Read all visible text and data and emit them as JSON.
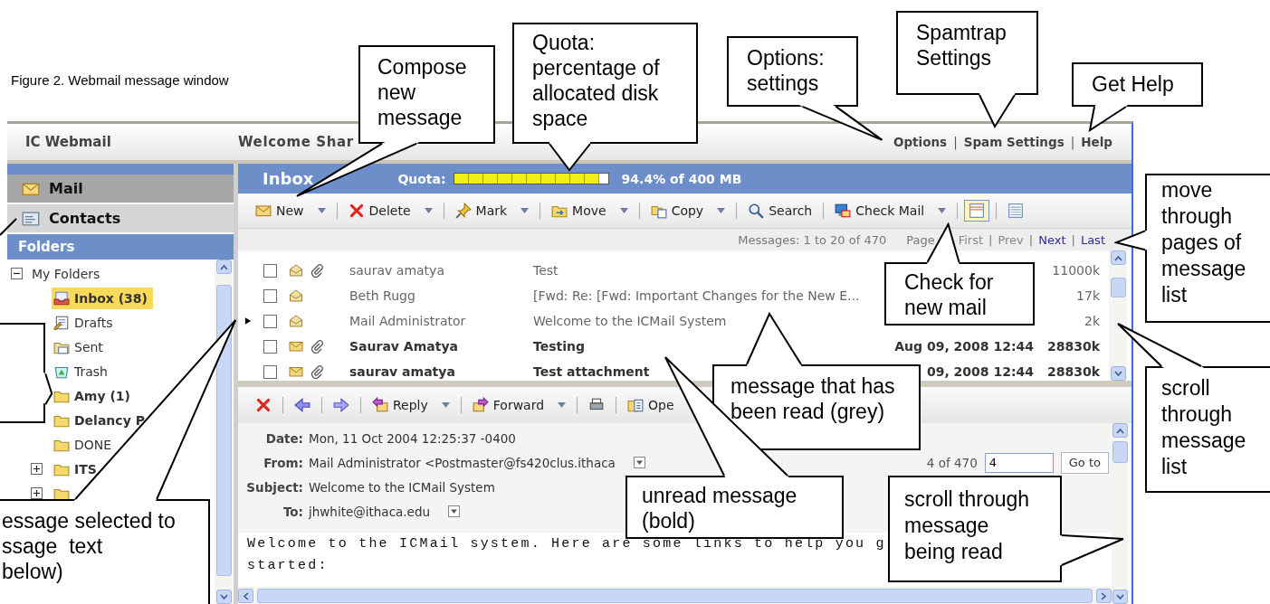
{
  "caption": "Figure 2. Webmail message window",
  "header": {
    "app_name": "IC Webmail",
    "welcome": "Welcome Shar",
    "separator": "|",
    "links": [
      "Options",
      "Spam Settings",
      "Help"
    ]
  },
  "sidebar": {
    "nav": [
      {
        "label": "Mail",
        "kind": "mail",
        "selected": true
      },
      {
        "label": "Contacts",
        "kind": "contacts",
        "selected": false
      }
    ],
    "folders_title": "Folders",
    "tree": [
      {
        "label": "My Folders",
        "kind": "group",
        "expanded": true,
        "children": [
          {
            "label": "Inbox (38)",
            "kind": "inbox",
            "selected": true,
            "unread": true,
            "collapsed": false
          },
          {
            "label": "Drafts",
            "kind": "drafts",
            "selected": false,
            "unread": false,
            "collapsed": false
          },
          {
            "label": "Sent",
            "kind": "sent",
            "selected": false,
            "unread": false,
            "collapsed": false
          },
          {
            "label": "Trash",
            "kind": "trash",
            "selected": false,
            "unread": false,
            "collapsed": false
          },
          {
            "label": "Amy (1)",
            "kind": "folder",
            "selected": false,
            "unread": true,
            "collapsed": false
          },
          {
            "label": "Delancy P",
            "kind": "folder",
            "selected": false,
            "unread": true,
            "collapsed": false
          },
          {
            "label": "DONE",
            "kind": "folder",
            "selected": false,
            "unread": false,
            "collapsed": false
          },
          {
            "label": "ITS",
            "kind": "folder",
            "selected": false,
            "unread": true,
            "collapsed": true
          },
          {
            "kind": "folder",
            "selected": false,
            "unread": true,
            "collapsed": true
          }
        ]
      }
    ]
  },
  "mailbox": {
    "title": "Inbox",
    "quota_label": "Quota:",
    "quota": {
      "level": 0.944
    },
    "quota_text": "94.4% of 400 MB"
  },
  "toolbar": [
    {
      "label": "New",
      "kind": "new",
      "dropdown": true
    },
    {
      "label": "Delete",
      "kind": "delete",
      "dropdown": true
    },
    {
      "label": "Mark",
      "kind": "mark",
      "dropdown": true
    },
    {
      "label": "Move",
      "kind": "move",
      "dropdown": true
    },
    {
      "label": "Copy",
      "kind": "copy",
      "dropdown": true
    },
    {
      "label": "Search",
      "kind": "search",
      "dropdown": false
    },
    {
      "label": "Check Mail",
      "kind": "check-mail",
      "dropdown": true
    }
  ],
  "views": [
    {
      "kind": "split",
      "selected": true
    },
    {
      "kind": "list",
      "selected": false
    }
  ],
  "pager": {
    "summary": "Messages: 1 to 20 of 470",
    "label": "Page",
    "separator": "|",
    "links": [
      {
        "label": "First",
        "disabled": true
      },
      {
        "label": "Prev",
        "disabled": true
      },
      {
        "label": "Next",
        "disabled": false
      },
      {
        "label": "Last",
        "disabled": false
      }
    ]
  },
  "messages": [
    {
      "current": false,
      "checked": false,
      "read": true,
      "attachment": true,
      "sender": "saurav amatya",
      "subject": "Test",
      "size": "11000k"
    },
    {
      "current": false,
      "checked": false,
      "read": true,
      "attachment": false,
      "sender": "Beth Rugg",
      "subject": "[Fwd: Re: [Fwd: Important Changes for the New E...",
      "size": "17k"
    },
    {
      "current": true,
      "checked": false,
      "read": true,
      "attachment": false,
      "sender": "Mail Administrator",
      "subject": "Welcome to the ICMail System",
      "size": "2k"
    },
    {
      "current": false,
      "checked": false,
      "read": false,
      "attachment": true,
      "sender": "Saurav Amatya",
      "subject": "Testing",
      "date": "Aug 09, 2008 12:44",
      "size": "28830k"
    },
    {
      "current": false,
      "checked": false,
      "read": false,
      "attachment": true,
      "sender": "saurav amatya",
      "subject": "Test attachment",
      "date": "09, 2008 12:44",
      "size": "28830k"
    }
  ],
  "reader": {
    "toolbar": [
      {
        "kind": "delete"
      },
      {
        "kind": "previous"
      },
      {
        "kind": "next"
      },
      {
        "kind": "reply",
        "label": "Reply",
        "dropdown": true
      },
      {
        "kind": "forward",
        "label": "Forward",
        "dropdown": true
      },
      {
        "kind": "print"
      },
      {
        "kind": "open",
        "label": "Ope"
      }
    ],
    "headers": [
      {
        "label": "Date:",
        "value": "Mon, 11 Oct 2004 12:25:37 -0400",
        "menu": false
      },
      {
        "label": "From:",
        "value": "Mail Administrator <Postmaster@fs420clus.ithaca",
        "menu": true
      },
      {
        "label": "Subject:",
        "value": "Welcome to the ICMail System",
        "menu": false
      },
      {
        "label": "To:",
        "value": "jhwhite@ithaca.edu",
        "menu": true
      }
    ],
    "position": "4 of 470",
    "goto_value": "4",
    "goto_button": "Go to",
    "body": [
      "Welcome to the ICMail system. Here are some links to help you g",
      "started:"
    ]
  },
  "callouts": [
    {
      "lines": [
        "Compose",
        "new",
        "message"
      ]
    },
    {
      "lines": [
        "Quota:",
        "percentage of",
        "allocated disk",
        "space"
      ]
    },
    {
      "lines": [
        "Options:",
        "settings"
      ]
    },
    {
      "lines": [
        "Spamtrap",
        "Settings"
      ]
    },
    {
      "lines": [
        "Get Help"
      ]
    },
    {
      "lines": [
        "move",
        "through",
        "pages of",
        "message",
        "list"
      ]
    },
    {
      "lines": [
        "Check for",
        "new mail"
      ]
    },
    {
      "lines": [
        "message that has",
        "been read (grey)"
      ]
    },
    {
      "lines": [
        "scroll",
        "through",
        "message",
        "list"
      ]
    },
    {
      "lines": [
        "unread message",
        "(bold)"
      ]
    },
    {
      "lines": [
        "scroll through",
        "message",
        "being read"
      ]
    },
    {
      "lines": [
        "essage selected to",
        "ssage  text",
        "below)"
      ]
    }
  ]
}
